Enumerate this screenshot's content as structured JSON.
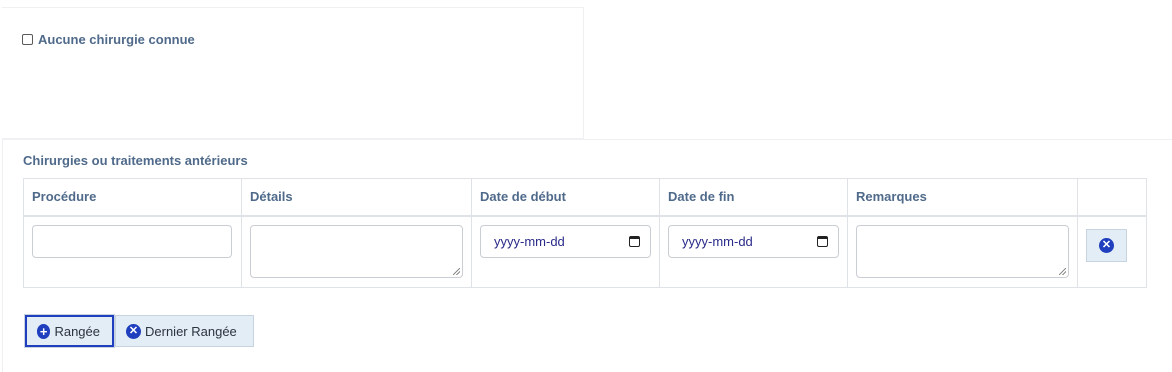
{
  "no_surgery": {
    "label": "Aucune chirurgie connue",
    "checked": false
  },
  "section": {
    "title": "Chirurgies ou traitements antérieurs"
  },
  "table": {
    "columns": [
      "Procédure",
      "Détails",
      "Date de début",
      "Date de fin",
      "Remarques"
    ],
    "row": {
      "procedure": "",
      "details": "",
      "start_date_placeholder": "yyyy-mm-dd",
      "end_date_placeholder": "yyyy-mm-dd",
      "remarks": ""
    }
  },
  "buttons": {
    "add_row": "Rangée",
    "remove_last_row": "Dernier Rangée"
  },
  "icons": {
    "add": "plus-circle-icon",
    "remove": "x-circle-icon",
    "calendar": "calendar-icon"
  },
  "colors": {
    "accent": "#1f3fbf",
    "label": "#4f6a8a",
    "button_bg": "#e3edf5"
  }
}
